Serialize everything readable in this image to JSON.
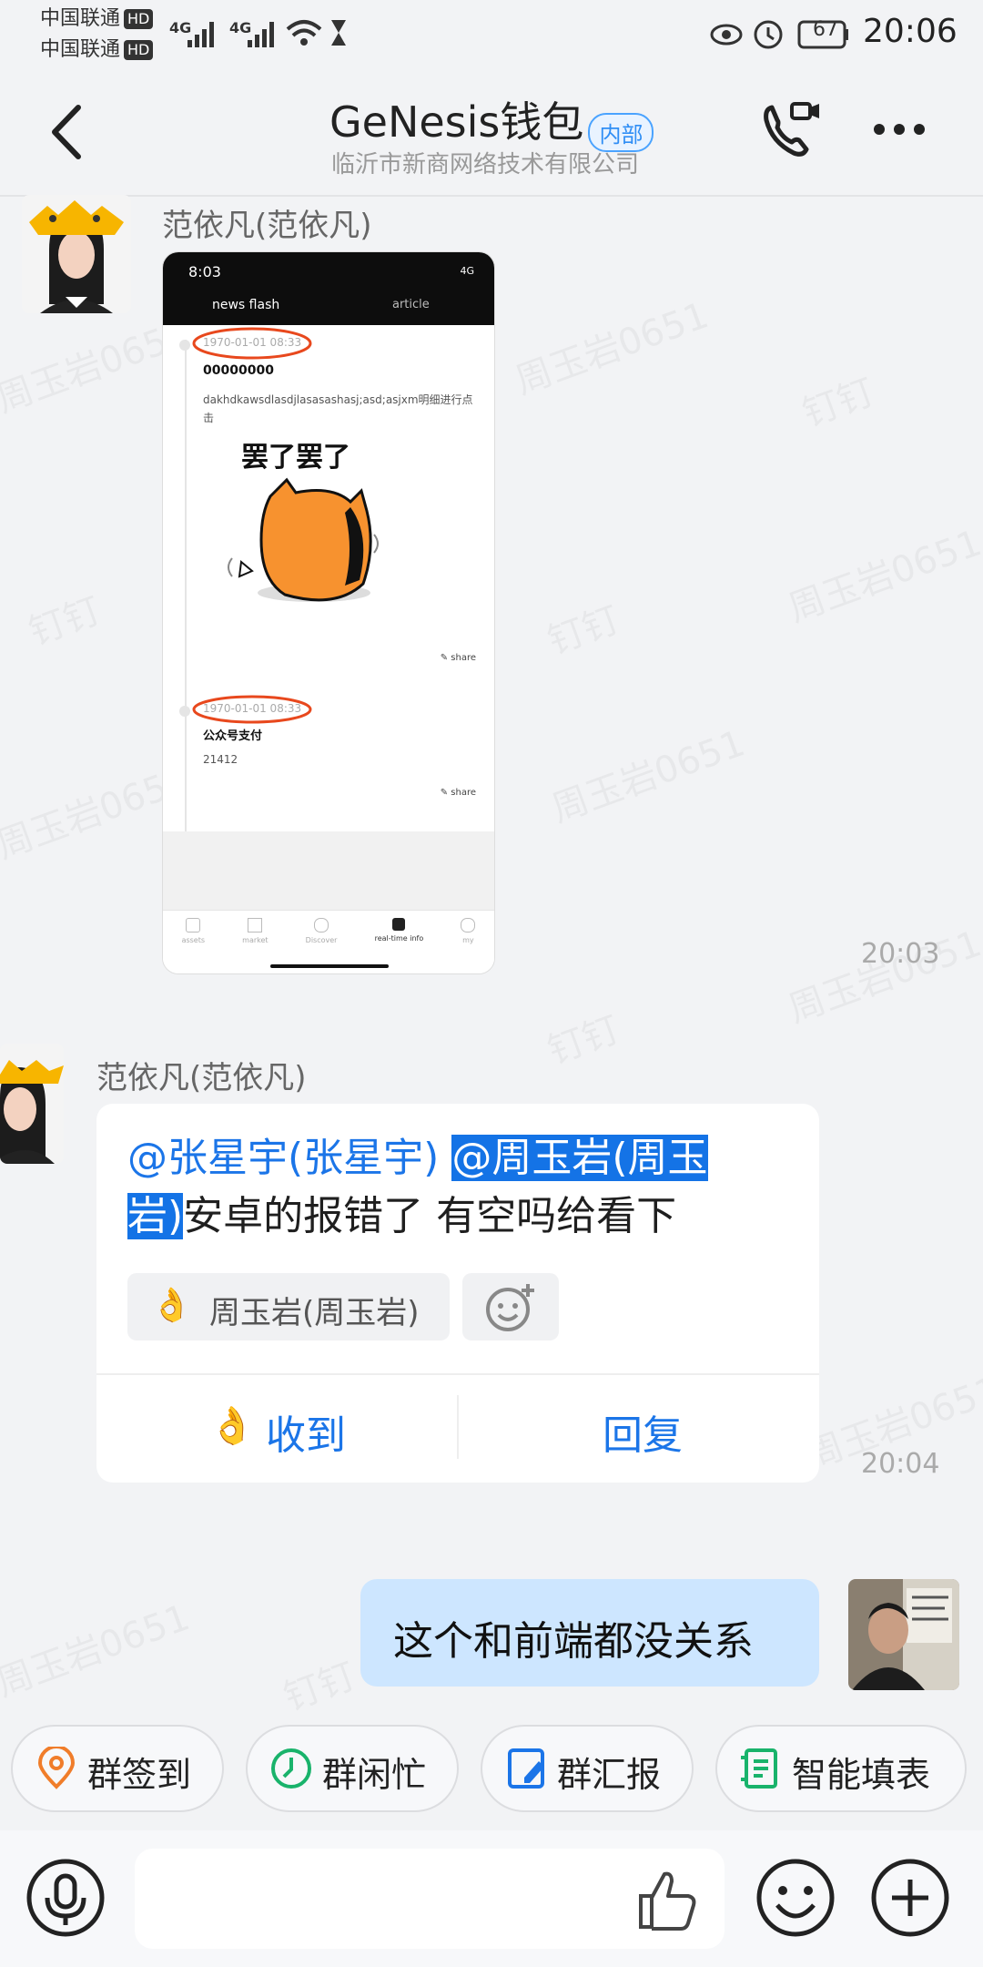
{
  "status_bar": {
    "carrier1": "中国联通",
    "carrier2": "中国联通",
    "hd": "HD",
    "signal_label1": "4G",
    "signal_label2": "4G",
    "battery": "67",
    "time": "20:06"
  },
  "header": {
    "title": "GeNesis钱包",
    "badge": "内部",
    "subtitle": "临沂市新商网络技术有限公司"
  },
  "messages": [
    {
      "sender": "范依凡(范依凡)",
      "time": "20:03",
      "screenshot": {
        "status_time": "8:03",
        "status_net": "4G",
        "tab_active": "news flash",
        "tab_other": "article",
        "item1_date": "1970-01-01 08:33",
        "item1_title": "00000000",
        "item1_body": "dakhdkawsdlasdjlasasashasj;asd;asjxm明细进行点击",
        "sticker_text": "罢了罢了",
        "share": "share",
        "item2_date": "1970-01-01 08:33",
        "item2_title": "公众号支付",
        "item2_body": "21412",
        "nav": [
          "assets",
          "market",
          "Discover",
          "real-time info",
          "my"
        ]
      }
    },
    {
      "sender": "范依凡(范依凡)",
      "time": "20:04",
      "mention1": "@张星宇(张星宇)",
      "mention2a": "@周玉岩(周玉",
      "mention2b": "岩)",
      "text": "安卓的报错了 有空吗给看下",
      "reaction_user": "周玉岩(周玉岩)",
      "ack_label": "收到",
      "reply_label": "回复"
    },
    {
      "text": "这个和前端都没关系"
    }
  ],
  "watermark": "周玉岩0651",
  "watermark2": "钉钉",
  "quick_actions": [
    "群签到",
    "群闲忙",
    "群汇报",
    "智能填表"
  ],
  "colors": {
    "accent": "#1b75e8",
    "self_bubble": "#cde6ff",
    "background": "#f2f3f5"
  }
}
